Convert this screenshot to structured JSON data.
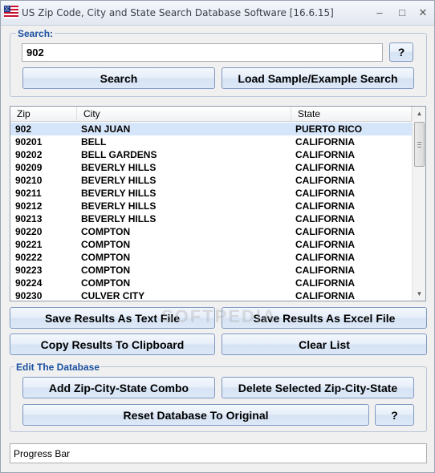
{
  "window": {
    "title": "US Zip Code, City and State Search Database Software [16.6.15]",
    "minimize_glyph": "–",
    "maximize_glyph": "□",
    "close_glyph": "✕"
  },
  "search": {
    "group_label": "Search:",
    "value": "902",
    "help_label": "?",
    "search_label": "Search",
    "load_sample_label": "Load Sample/Example Search"
  },
  "results": {
    "columns": [
      "Zip",
      "City",
      "State"
    ],
    "rows": [
      {
        "zip": "902",
        "city": "SAN JUAN",
        "state": "PUERTO RICO"
      },
      {
        "zip": "90201",
        "city": "BELL",
        "state": "CALIFORNIA"
      },
      {
        "zip": "90202",
        "city": "BELL GARDENS",
        "state": "CALIFORNIA"
      },
      {
        "zip": "90209",
        "city": "BEVERLY HILLS",
        "state": "CALIFORNIA"
      },
      {
        "zip": "90210",
        "city": "BEVERLY HILLS",
        "state": "CALIFORNIA"
      },
      {
        "zip": "90211",
        "city": "BEVERLY HILLS",
        "state": "CALIFORNIA"
      },
      {
        "zip": "90212",
        "city": "BEVERLY HILLS",
        "state": "CALIFORNIA"
      },
      {
        "zip": "90213",
        "city": "BEVERLY HILLS",
        "state": "CALIFORNIA"
      },
      {
        "zip": "90220",
        "city": "COMPTON",
        "state": "CALIFORNIA"
      },
      {
        "zip": "90221",
        "city": "COMPTON",
        "state": "CALIFORNIA"
      },
      {
        "zip": "90222",
        "city": "COMPTON",
        "state": "CALIFORNIA"
      },
      {
        "zip": "90223",
        "city": "COMPTON",
        "state": "CALIFORNIA"
      },
      {
        "zip": "90224",
        "city": "COMPTON",
        "state": "CALIFORNIA"
      },
      {
        "zip": "90230",
        "city": "CULVER CITY",
        "state": "CALIFORNIA"
      }
    ],
    "selected_index": 0
  },
  "actions": {
    "save_text_label": "Save Results As Text File",
    "save_excel_label": "Save Results As Excel File",
    "copy_label": "Copy Results To Clipboard",
    "clear_label": "Clear List"
  },
  "edit": {
    "group_label": "Edit The Database",
    "add_label": "Add Zip-City-State Combo",
    "delete_label": "Delete Selected Zip-City-State",
    "reset_label": "Reset Database To Original",
    "help_label": "?"
  },
  "progress": {
    "label": "Progress Bar"
  },
  "watermark": "SOFTPEDIA",
  "colors": {
    "group_label": "#1a4fa0",
    "selected_row": "#d6e6fa",
    "button_border": "#7e97bf"
  }
}
